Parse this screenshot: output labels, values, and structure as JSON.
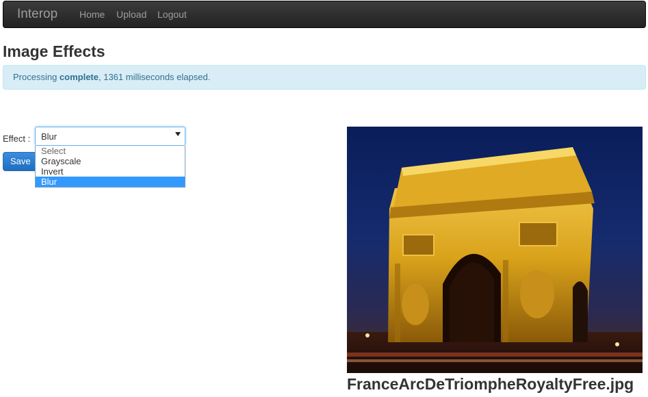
{
  "navbar": {
    "brand": "Interop",
    "links": [
      "Home",
      "Upload",
      "Logout"
    ]
  },
  "page": {
    "title": "Image Effects"
  },
  "alert": {
    "prefix": "Processing ",
    "bold": "complete",
    "suffix": ", 1361 milliseconds elapsed."
  },
  "form": {
    "effect_label": "Effect :",
    "selected_value": "Blur",
    "options": [
      "Select",
      "Grayscale",
      "Invert",
      "Blur"
    ],
    "save_label": "Save"
  },
  "image": {
    "filename": "FranceArcDeTriompheRoyaltyFree.jpg"
  },
  "colors": {
    "navbar_bg": "#222222",
    "alert_bg": "#d9edf7",
    "alert_text": "#31708f",
    "primary_button": "#2a7bd0",
    "selected_option": "#3399ff"
  }
}
